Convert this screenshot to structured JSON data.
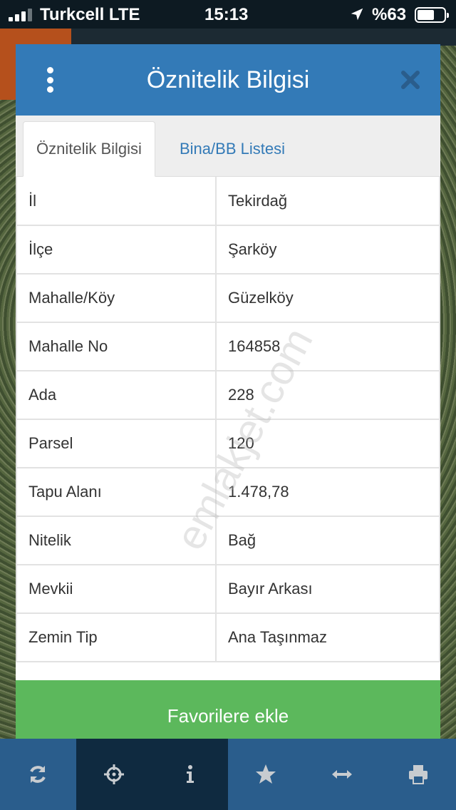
{
  "status_bar": {
    "carrier": "Turkcell  LTE",
    "time": "15:13",
    "battery_percent": "%63",
    "battery_level": 0.63
  },
  "modal": {
    "title": "Öznitelik Bilgisi",
    "menu_icon": "vertical-dots-icon",
    "close_icon": "close-icon",
    "tabs": [
      {
        "label": "Öznitelik Bilgisi",
        "active": true
      },
      {
        "label": "Bina/BB Listesi",
        "active": false
      }
    ],
    "rows": [
      {
        "key": "İl",
        "value": "Tekirdağ"
      },
      {
        "key": "İlçe",
        "value": "Şarköy"
      },
      {
        "key": "Mahalle/Köy",
        "value": "Güzelköy"
      },
      {
        "key": "Mahalle No",
        "value": "164858"
      },
      {
        "key": "Ada",
        "value": "228"
      },
      {
        "key": "Parsel",
        "value": "120"
      },
      {
        "key": "Tapu Alanı",
        "value": "1.478,78"
      },
      {
        "key": "Nitelik",
        "value": "Bağ"
      },
      {
        "key": "Mevkii",
        "value": "Bayır Arkası"
      },
      {
        "key": "Zemin Tip",
        "value": "Ana Taşınmaz"
      }
    ],
    "favorite_button": "Favorilere ekle"
  },
  "watermark": "emlakjet.com",
  "toolbar": {
    "items": [
      {
        "icon": "refresh-icon",
        "active": false
      },
      {
        "icon": "crosshair-icon",
        "active": true
      },
      {
        "icon": "info-icon",
        "active": true
      },
      {
        "icon": "star-icon",
        "active": false
      },
      {
        "icon": "horizontal-arrows-icon",
        "active": false
      },
      {
        "icon": "print-icon",
        "active": false
      }
    ]
  },
  "colors": {
    "header_blue": "#337ab7",
    "button_green": "#5cb85c",
    "toolbar_blue": "#2a5d8c",
    "toolbar_active": "#0f2a40"
  }
}
